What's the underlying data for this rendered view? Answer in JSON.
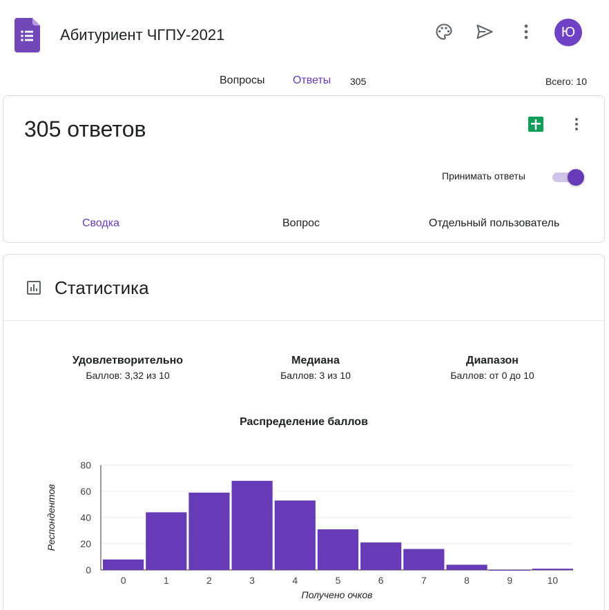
{
  "header": {
    "title": "Абитуриент ЧГПУ-2021",
    "avatar_letter": "Ю",
    "icons": [
      "forms-logo-icon",
      "palette-icon",
      "send-icon",
      "more-vert-icon"
    ]
  },
  "tabs": {
    "questions": "Вопросы",
    "responses": "Ответы",
    "responses_count": "305",
    "total": "Всего: 10"
  },
  "responses_card": {
    "title": "305 ответов",
    "accept_label": "Принимать ответы",
    "accept_on": true,
    "subtabs": [
      "Сводка",
      "Вопрос",
      "Отдельный пользователь"
    ]
  },
  "stats_card": {
    "title": "Статистика",
    "metrics": [
      {
        "label": "Удовлетворительно",
        "value": "Баллов: 3,32 из 10"
      },
      {
        "label": "Медиана",
        "value": "Баллов: 3 из 10"
      },
      {
        "label": "Диапазон",
        "value": "Баллов: от 0 до 10"
      }
    ]
  },
  "colors": {
    "accent": "#673ab7",
    "bar": "#673ab7",
    "sheets": "#0f9d58"
  },
  "chart_data": {
    "type": "bar",
    "title": "Распределение баллов",
    "xlabel": "Получено очков",
    "ylabel": "Респондентов",
    "categories": [
      "0",
      "1",
      "2",
      "3",
      "4",
      "5",
      "6",
      "7",
      "8",
      "9",
      "10"
    ],
    "values": [
      8,
      44,
      59,
      68,
      53,
      31,
      21,
      16,
      4,
      0,
      1
    ],
    "yticks": [
      0,
      20,
      40,
      60,
      80
    ],
    "ylim": [
      0,
      80
    ],
    "grid": true
  }
}
